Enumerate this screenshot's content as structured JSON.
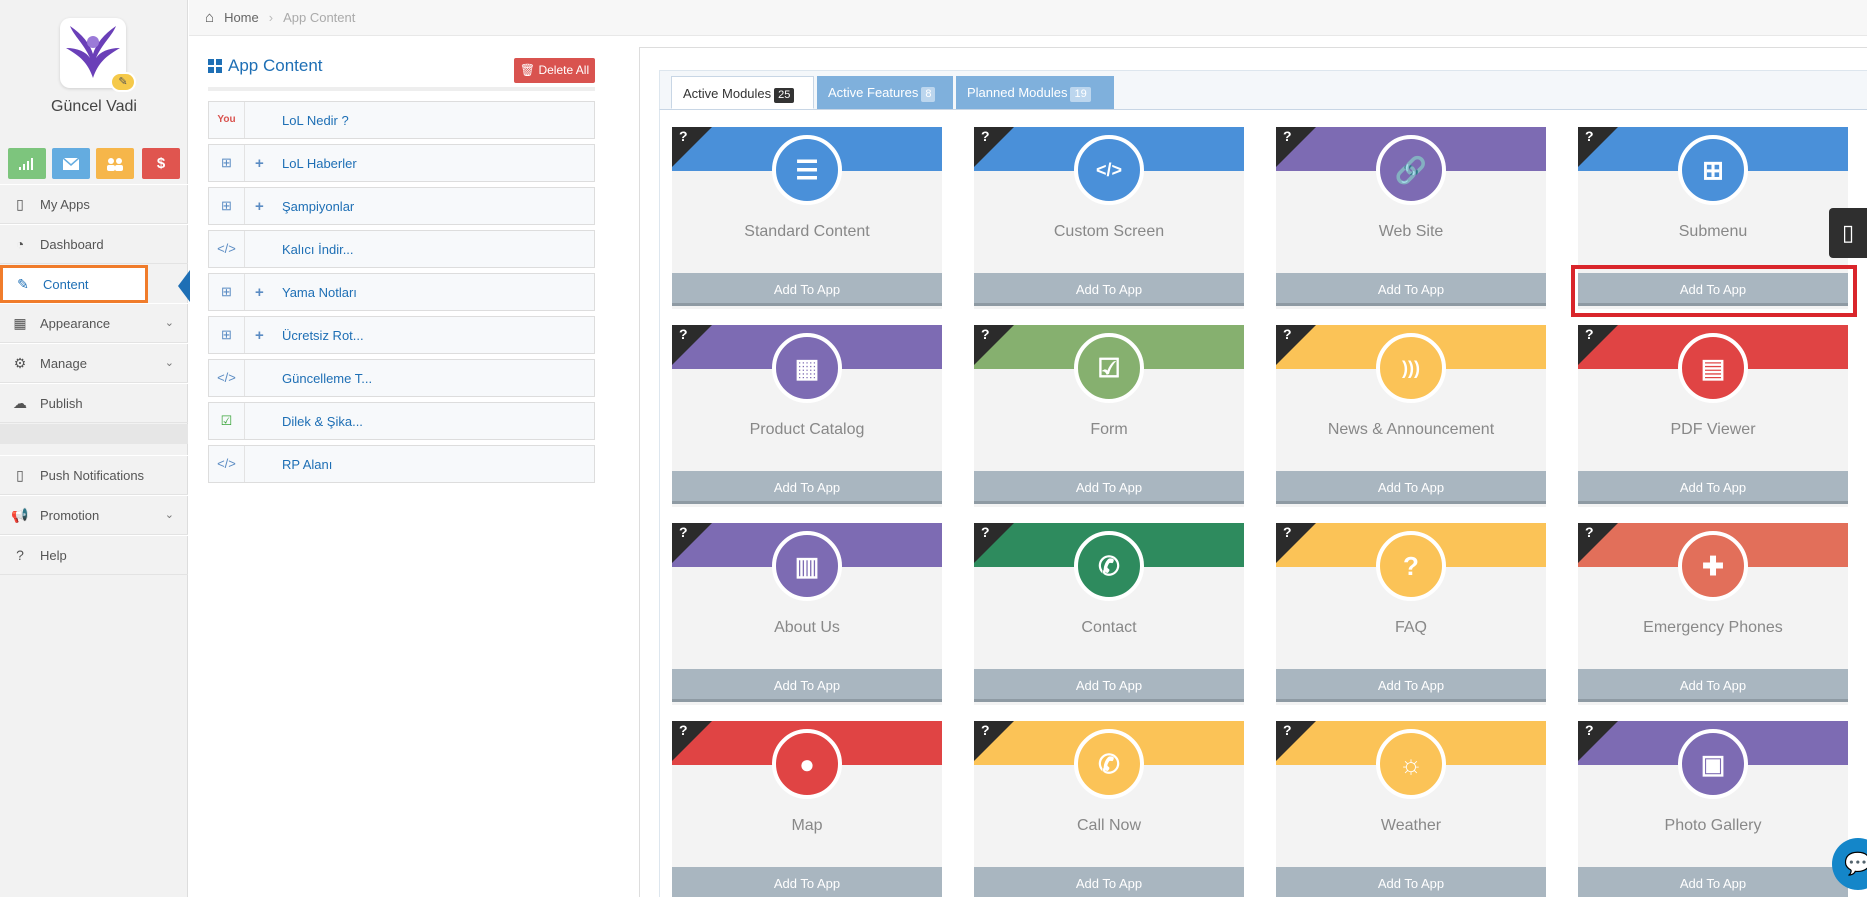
{
  "sidebar": {
    "app_name": "Güncel Vadi",
    "quick_buttons": [
      {
        "icon": "signal-icon",
        "color": "#7dc57d"
      },
      {
        "icon": "mail-icon",
        "color": "#64ace0"
      },
      {
        "icon": "users-icon",
        "color": "#f6b64a"
      },
      {
        "icon": "dollar-icon",
        "glyph": "$",
        "color": "#e0554f"
      }
    ],
    "items": [
      {
        "label": "My Apps",
        "icon": "mobile-icon"
      },
      {
        "label": "Dashboard",
        "icon": "dashboard-icon"
      },
      {
        "label": "Content",
        "icon": "edit-icon",
        "active": true
      },
      {
        "label": "Appearance",
        "icon": "grid-icon",
        "has_children": true
      },
      {
        "label": "Manage",
        "icon": "cogs-icon",
        "has_children": true
      },
      {
        "label": "Publish",
        "icon": "cloud-upload-icon"
      },
      {
        "label": "Push Notifications",
        "icon": "mobile-icon"
      },
      {
        "label": "Promotion",
        "icon": "bullhorn-icon",
        "has_children": true
      },
      {
        "label": "Help",
        "icon": "question-icon"
      }
    ]
  },
  "breadcrumb": {
    "home": "Home",
    "current": "App Content"
  },
  "panel": {
    "title": "App Content",
    "delete_all": "Delete All",
    "items": [
      {
        "label": "LoL Nedir ?",
        "icon": "youtube-icon",
        "expandable": false
      },
      {
        "label": "LoL Haberler",
        "icon": "sitemap-icon",
        "expandable": true
      },
      {
        "label": "Şampiyonlar",
        "icon": "sitemap-icon",
        "expandable": true
      },
      {
        "label": "Kalıcı İndir...",
        "icon": "code-icon",
        "expandable": false
      },
      {
        "label": "Yama Notları",
        "icon": "sitemap-icon",
        "expandable": true
      },
      {
        "label": "Ücretsiz Rot...",
        "icon": "sitemap-icon",
        "expandable": true
      },
      {
        "label": "Güncelleme T...",
        "icon": "code-icon",
        "expandable": false
      },
      {
        "label": "Dilek & Şika...",
        "icon": "check-icon",
        "expandable": false
      },
      {
        "label": "RP Alanı",
        "icon": "code-icon",
        "expandable": false
      }
    ]
  },
  "tabs": [
    {
      "label": "Active Modules",
      "count": "25"
    },
    {
      "label": "Active Features",
      "count": "8"
    },
    {
      "label": "Planned Modules",
      "count": "19"
    }
  ],
  "modules": {
    "add_label": "Add To App",
    "help_mark": "?",
    "cards": [
      {
        "title": "Standard Content",
        "icon": "list-icon",
        "color": "#4a90d9"
      },
      {
        "title": "Custom Screen",
        "icon": "code-icon",
        "color": "#4a90d9"
      },
      {
        "title": "Web Site",
        "icon": "link-icon",
        "color": "#7d6bb3"
      },
      {
        "title": "Submenu",
        "icon": "sitemap-icon",
        "color": "#4a90d9"
      },
      {
        "title": "Product Catalog",
        "icon": "grid-icon",
        "color": "#7d6bb3"
      },
      {
        "title": "Form",
        "icon": "checkbox-icon",
        "color": "#86b06f"
      },
      {
        "title": "News & Announcement",
        "icon": "rss-icon",
        "color": "#fbc357"
      },
      {
        "title": "PDF Viewer",
        "icon": "file-icon",
        "color": "#e04444"
      },
      {
        "title": "About Us",
        "icon": "building-icon",
        "color": "#7d6bb3"
      },
      {
        "title": "Contact",
        "icon": "phone-icon",
        "color": "#2e8b5e"
      },
      {
        "title": "FAQ",
        "icon": "question-circle-icon",
        "color": "#fbc357"
      },
      {
        "title": "Emergency Phones",
        "icon": "ambulance-icon",
        "color": "#e26f5a"
      },
      {
        "title": "Map",
        "icon": "map-marker-icon",
        "color": "#e04444"
      },
      {
        "title": "Call Now",
        "icon": "phone-square-icon",
        "color": "#fbc357"
      },
      {
        "title": "Weather",
        "icon": "sun-icon",
        "color": "#fbc357"
      },
      {
        "title": "Photo Gallery",
        "icon": "image-icon",
        "color": "#7d6bb3"
      }
    ]
  }
}
